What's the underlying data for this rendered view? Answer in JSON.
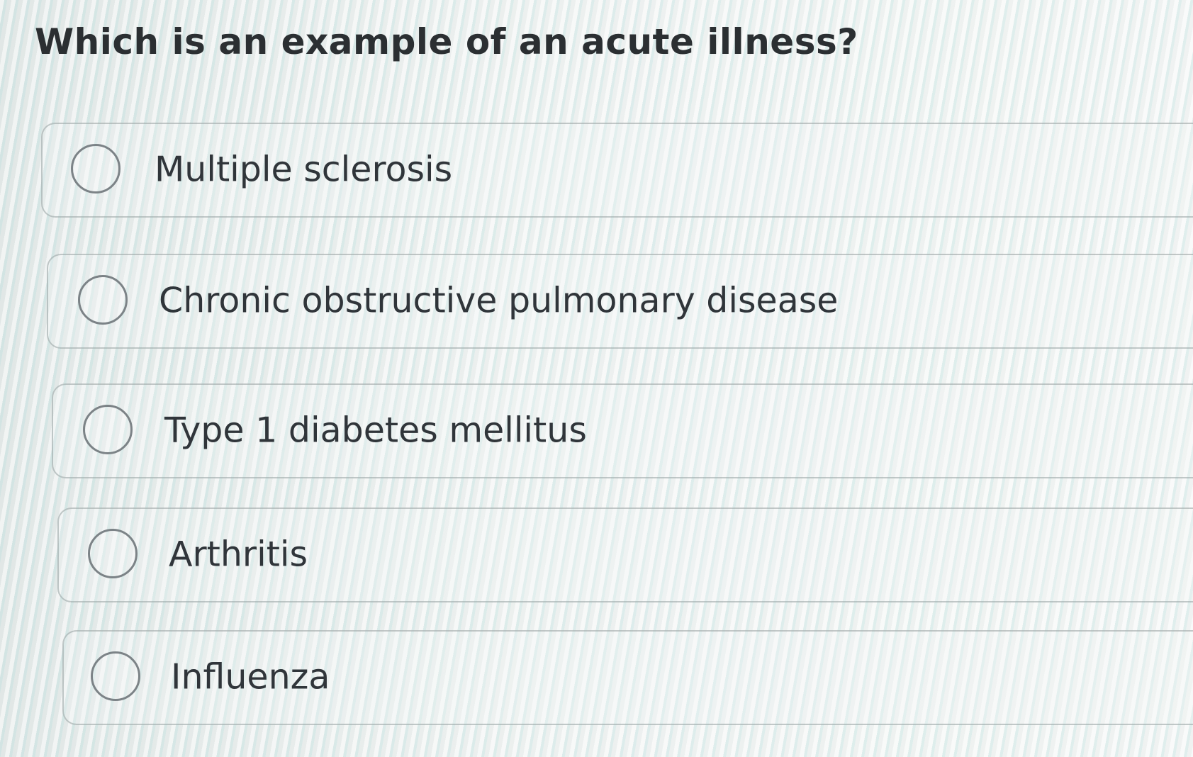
{
  "question": {
    "text": "Which is an example of an acute illness?"
  },
  "options": [
    {
      "label": "Multiple sclerosis",
      "selected": false
    },
    {
      "label": "Chronic obstructive pulmonary disease",
      "selected": false
    },
    {
      "label": "Type 1 diabetes mellitus",
      "selected": false
    },
    {
      "label": "Arthritis",
      "selected": false
    },
    {
      "label": "Influenza",
      "selected": false
    }
  ],
  "colors": {
    "text": "#2f3336",
    "radio_border": "#7c8387",
    "option_border": "#96a0a0"
  }
}
